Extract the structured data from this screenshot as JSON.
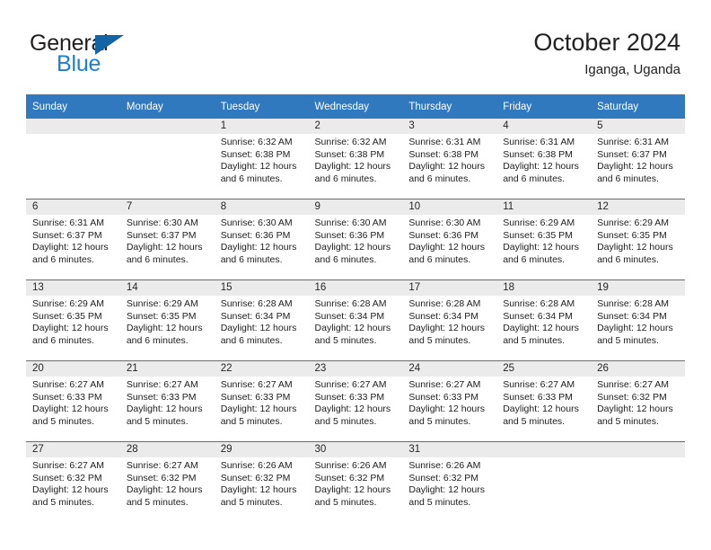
{
  "brand": {
    "word_one": "General",
    "word_two": "Blue",
    "logo_icon": "triangle-icon",
    "color_dark": "#231f20",
    "color_blue": "#1b7fd4",
    "color_triangle": "#1464a5"
  },
  "header": {
    "title": "October 2024",
    "subtitle": "Iganga, Uganda",
    "accent_color": "#3079bf",
    "daynum_band_color": "#ebebeb"
  },
  "weekday_headers": [
    "Sunday",
    "Monday",
    "Tuesday",
    "Wednesday",
    "Thursday",
    "Friday",
    "Saturday"
  ],
  "weeks": [
    [
      {
        "day": "",
        "empty": true,
        "lines": []
      },
      {
        "day": "",
        "empty": true,
        "lines": []
      },
      {
        "day": "1",
        "empty": false,
        "lines": [
          "Sunrise: 6:32 AM",
          "Sunset: 6:38 PM",
          "Daylight: 12 hours",
          "and 6 minutes."
        ]
      },
      {
        "day": "2",
        "empty": false,
        "lines": [
          "Sunrise: 6:32 AM",
          "Sunset: 6:38 PM",
          "Daylight: 12 hours",
          "and 6 minutes."
        ]
      },
      {
        "day": "3",
        "empty": false,
        "lines": [
          "Sunrise: 6:31 AM",
          "Sunset: 6:38 PM",
          "Daylight: 12 hours",
          "and 6 minutes."
        ]
      },
      {
        "day": "4",
        "empty": false,
        "lines": [
          "Sunrise: 6:31 AM",
          "Sunset: 6:38 PM",
          "Daylight: 12 hours",
          "and 6 minutes."
        ]
      },
      {
        "day": "5",
        "empty": false,
        "lines": [
          "Sunrise: 6:31 AM",
          "Sunset: 6:37 PM",
          "Daylight: 12 hours",
          "and 6 minutes."
        ]
      }
    ],
    [
      {
        "day": "6",
        "empty": false,
        "lines": [
          "Sunrise: 6:31 AM",
          "Sunset: 6:37 PM",
          "Daylight: 12 hours",
          "and 6 minutes."
        ]
      },
      {
        "day": "7",
        "empty": false,
        "lines": [
          "Sunrise: 6:30 AM",
          "Sunset: 6:37 PM",
          "Daylight: 12 hours",
          "and 6 minutes."
        ]
      },
      {
        "day": "8",
        "empty": false,
        "lines": [
          "Sunrise: 6:30 AM",
          "Sunset: 6:36 PM",
          "Daylight: 12 hours",
          "and 6 minutes."
        ]
      },
      {
        "day": "9",
        "empty": false,
        "lines": [
          "Sunrise: 6:30 AM",
          "Sunset: 6:36 PM",
          "Daylight: 12 hours",
          "and 6 minutes."
        ]
      },
      {
        "day": "10",
        "empty": false,
        "lines": [
          "Sunrise: 6:30 AM",
          "Sunset: 6:36 PM",
          "Daylight: 12 hours",
          "and 6 minutes."
        ]
      },
      {
        "day": "11",
        "empty": false,
        "lines": [
          "Sunrise: 6:29 AM",
          "Sunset: 6:35 PM",
          "Daylight: 12 hours",
          "and 6 minutes."
        ]
      },
      {
        "day": "12",
        "empty": false,
        "lines": [
          "Sunrise: 6:29 AM",
          "Sunset: 6:35 PM",
          "Daylight: 12 hours",
          "and 6 minutes."
        ]
      }
    ],
    [
      {
        "day": "13",
        "empty": false,
        "lines": [
          "Sunrise: 6:29 AM",
          "Sunset: 6:35 PM",
          "Daylight: 12 hours",
          "and 6 minutes."
        ]
      },
      {
        "day": "14",
        "empty": false,
        "lines": [
          "Sunrise: 6:29 AM",
          "Sunset: 6:35 PM",
          "Daylight: 12 hours",
          "and 6 minutes."
        ]
      },
      {
        "day": "15",
        "empty": false,
        "lines": [
          "Sunrise: 6:28 AM",
          "Sunset: 6:34 PM",
          "Daylight: 12 hours",
          "and 6 minutes."
        ]
      },
      {
        "day": "16",
        "empty": false,
        "lines": [
          "Sunrise: 6:28 AM",
          "Sunset: 6:34 PM",
          "Daylight: 12 hours",
          "and 5 minutes."
        ]
      },
      {
        "day": "17",
        "empty": false,
        "lines": [
          "Sunrise: 6:28 AM",
          "Sunset: 6:34 PM",
          "Daylight: 12 hours",
          "and 5 minutes."
        ]
      },
      {
        "day": "18",
        "empty": false,
        "lines": [
          "Sunrise: 6:28 AM",
          "Sunset: 6:34 PM",
          "Daylight: 12 hours",
          "and 5 minutes."
        ]
      },
      {
        "day": "19",
        "empty": false,
        "lines": [
          "Sunrise: 6:28 AM",
          "Sunset: 6:34 PM",
          "Daylight: 12 hours",
          "and 5 minutes."
        ]
      }
    ],
    [
      {
        "day": "20",
        "empty": false,
        "lines": [
          "Sunrise: 6:27 AM",
          "Sunset: 6:33 PM",
          "Daylight: 12 hours",
          "and 5 minutes."
        ]
      },
      {
        "day": "21",
        "empty": false,
        "lines": [
          "Sunrise: 6:27 AM",
          "Sunset: 6:33 PM",
          "Daylight: 12 hours",
          "and 5 minutes."
        ]
      },
      {
        "day": "22",
        "empty": false,
        "lines": [
          "Sunrise: 6:27 AM",
          "Sunset: 6:33 PM",
          "Daylight: 12 hours",
          "and 5 minutes."
        ]
      },
      {
        "day": "23",
        "empty": false,
        "lines": [
          "Sunrise: 6:27 AM",
          "Sunset: 6:33 PM",
          "Daylight: 12 hours",
          "and 5 minutes."
        ]
      },
      {
        "day": "24",
        "empty": false,
        "lines": [
          "Sunrise: 6:27 AM",
          "Sunset: 6:33 PM",
          "Daylight: 12 hours",
          "and 5 minutes."
        ]
      },
      {
        "day": "25",
        "empty": false,
        "lines": [
          "Sunrise: 6:27 AM",
          "Sunset: 6:33 PM",
          "Daylight: 12 hours",
          "and 5 minutes."
        ]
      },
      {
        "day": "26",
        "empty": false,
        "lines": [
          "Sunrise: 6:27 AM",
          "Sunset: 6:32 PM",
          "Daylight: 12 hours",
          "and 5 minutes."
        ]
      }
    ],
    [
      {
        "day": "27",
        "empty": false,
        "lines": [
          "Sunrise: 6:27 AM",
          "Sunset: 6:32 PM",
          "Daylight: 12 hours",
          "and 5 minutes."
        ]
      },
      {
        "day": "28",
        "empty": false,
        "lines": [
          "Sunrise: 6:27 AM",
          "Sunset: 6:32 PM",
          "Daylight: 12 hours",
          "and 5 minutes."
        ]
      },
      {
        "day": "29",
        "empty": false,
        "lines": [
          "Sunrise: 6:26 AM",
          "Sunset: 6:32 PM",
          "Daylight: 12 hours",
          "and 5 minutes."
        ]
      },
      {
        "day": "30",
        "empty": false,
        "lines": [
          "Sunrise: 6:26 AM",
          "Sunset: 6:32 PM",
          "Daylight: 12 hours",
          "and 5 minutes."
        ]
      },
      {
        "day": "31",
        "empty": false,
        "lines": [
          "Sunrise: 6:26 AM",
          "Sunset: 6:32 PM",
          "Daylight: 12 hours",
          "and 5 minutes."
        ]
      },
      {
        "day": "",
        "empty": true,
        "lines": []
      },
      {
        "day": "",
        "empty": true,
        "lines": []
      }
    ]
  ]
}
